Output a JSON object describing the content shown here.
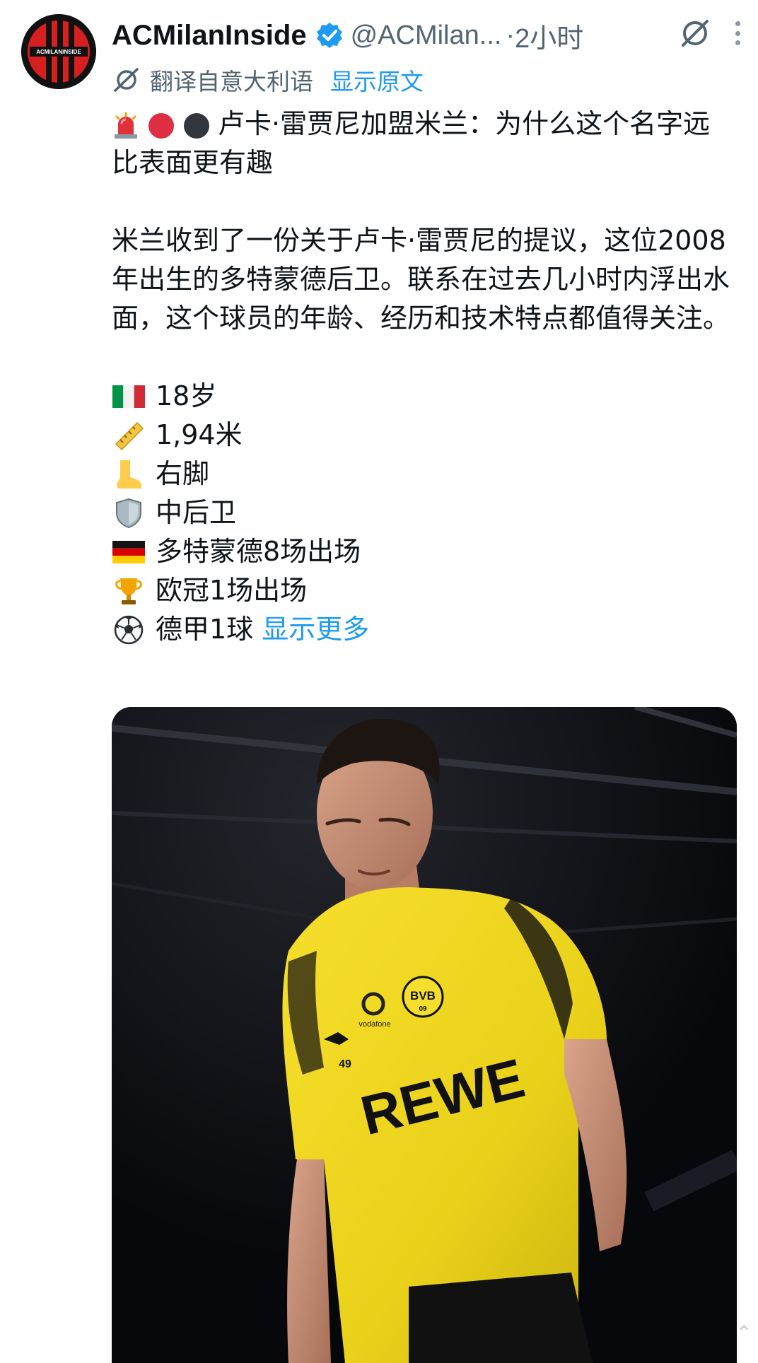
{
  "header": {
    "display_name": "ACMilanInside",
    "handle": "@ACMilan...",
    "separator": "·",
    "time": "2小时",
    "avatar_text": "ACMILANINSIDE",
    "verified_icon": "verified-badge-icon",
    "grok_icon": "grok-icon",
    "more_icon": "more-dots-icon"
  },
  "translation": {
    "label": "翻译自意大利语",
    "show_original": "显示原文"
  },
  "post": {
    "title": "卢卡·雷贾尼加盟米兰：为什么这个名字远比表面更有趣",
    "title_emojis": [
      "siren",
      "red-circle",
      "black-circle"
    ],
    "paragraph": "米兰收到了一份关于卢卡·雷贾尼的提议，这位2008年出生的多特蒙德后卫。联系在过去几小时内浮出水面，这个球员的年龄、经历和技术特点都值得关注。",
    "facts": [
      {
        "icon": "italy-flag-icon",
        "text": "18岁"
      },
      {
        "icon": "ruler-icon",
        "text": "1,94米"
      },
      {
        "icon": "foot-icon",
        "text": "右脚"
      },
      {
        "icon": "shield-icon",
        "text": "中后卫"
      },
      {
        "icon": "germany-flag-icon",
        "text": "多特蒙德8场出场"
      },
      {
        "icon": "trophy-icon",
        "text": "欧冠1场出场"
      },
      {
        "icon": "soccer-ball-icon",
        "text": "德甲1球"
      }
    ],
    "show_more": "显示更多"
  },
  "media": {
    "jersey_sponsor": "REWE",
    "jersey_brand": "vodafone",
    "club_crest": "BVB",
    "crest_year": "09",
    "shirt_number": "49"
  },
  "colors": {
    "accent": "#1d9bf0",
    "secondary_text": "#536471",
    "jersey_yellow": "#f1d820"
  }
}
